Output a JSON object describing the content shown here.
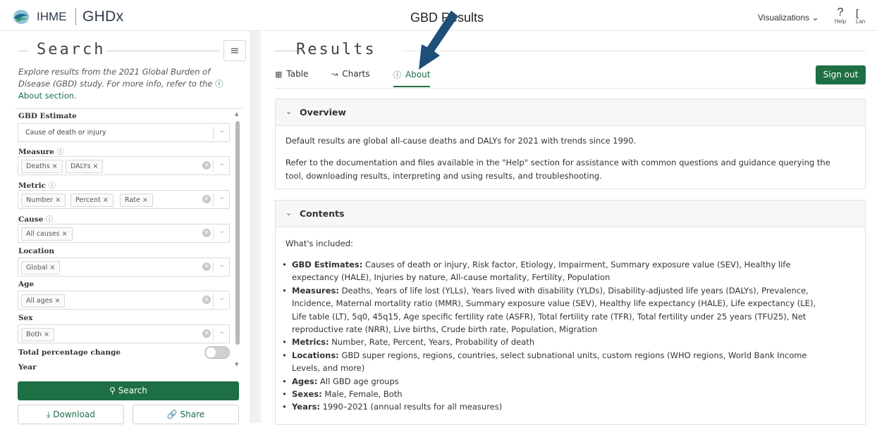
{
  "header": {
    "brand": "IHME",
    "brand2": "GHDx",
    "page_title": "GBD Results",
    "visualizations": "Visualizations",
    "help_icon": "?",
    "help_label": "Help",
    "lang_icon": "[",
    "lang_label": "Lan"
  },
  "sidebar": {
    "title": "Search",
    "intro": "Explore results from the 2021 Global Burden of Disease (GBD) study. For more info, refer to the",
    "about_link": "About section.",
    "filters": {
      "gbd_estimate": {
        "label": "GBD Estimate",
        "placeholder": "Cause of death or injury"
      },
      "measure": {
        "label": "Measure",
        "chips": [
          "Deaths",
          "DALYs"
        ]
      },
      "metric": {
        "label": "Metric",
        "chips": [
          "Number",
          "Percent",
          "Rate"
        ]
      },
      "cause": {
        "label": "Cause",
        "chips": [
          "All causes"
        ]
      },
      "location": {
        "label": "Location",
        "chips": [
          "Global"
        ]
      },
      "age": {
        "label": "Age",
        "chips": [
          "All ages"
        ]
      },
      "sex": {
        "label": "Sex",
        "chips": [
          "Both"
        ]
      },
      "total_change": {
        "label": "Total percentage change",
        "enabled": false
      },
      "year": {
        "label": "Year"
      }
    },
    "buttons": {
      "search": "Search",
      "download": "Download",
      "share": "Share"
    }
  },
  "main": {
    "title": "Results",
    "tabs": [
      {
        "label": "Table",
        "icon": "table-icon"
      },
      {
        "label": "Charts",
        "icon": "chart-icon"
      },
      {
        "label": "About",
        "icon": "help-circle-icon",
        "active": true
      }
    ],
    "sign_out": "Sign out",
    "overview": {
      "title": "Overview",
      "p1": "Default results are global all-cause deaths and DALYs for 2021 with trends since 1990.",
      "p2a": "Refer to the documentation and files available in the \"Help\" section for assistance with common questions and guidance querying the",
      "p2b": "tool, downloading results, interpreting and using results, and troubleshooting."
    },
    "contents": {
      "title": "Contents",
      "intro": "What's included:",
      "items": [
        {
          "term": "GBD Estimates:",
          "lines": [
            "Causes of death or injury, Risk factor, Etiology, Impairment, Summary exposure value (SEV), Healthy life",
            "expectancy (HALE), Injuries by nature, All-cause mortality, Fertility, Population"
          ]
        },
        {
          "term": "Measures:",
          "lines": [
            "Deaths, Years of life lost (YLLs), Years lived with disability (YLDs), Disability-adjusted life years (DALYs), Prevalence,",
            "Incidence, Maternal mortality ratio (MMR), Summary exposure value (SEV), Healthy life expectancy (HALE), Life expectancy (LE),",
            "Life table (LT), 5q0, 45q15, Age specific fertility rate (ASFR), Total fertility rate (TFR), Total fertility under 25 years (TFU25), Net",
            "reproductive rate (NRR), Live births, Crude birth rate, Population, Migration"
          ]
        },
        {
          "term": "Metrics:",
          "lines": [
            "Number, Rate, Percent, Years, Probability of death"
          ]
        },
        {
          "term": "Locations:",
          "lines": [
            "GBD super regions, regions, countries, select subnational units, custom regions (WHO regions, World Bank Income",
            "Levels, and more)"
          ]
        },
        {
          "term": "Ages:",
          "lines": [
            "All GBD age groups"
          ]
        },
        {
          "term": "Sexes:",
          "lines": [
            "Male, Female, Both"
          ]
        },
        {
          "term": "Years:",
          "lines": [
            "1990–2021 (annual results for all measures)"
          ]
        }
      ]
    }
  },
  "colors": {
    "brand_green": "#1e6f43",
    "annotation_arrow": "#1f4e79"
  }
}
